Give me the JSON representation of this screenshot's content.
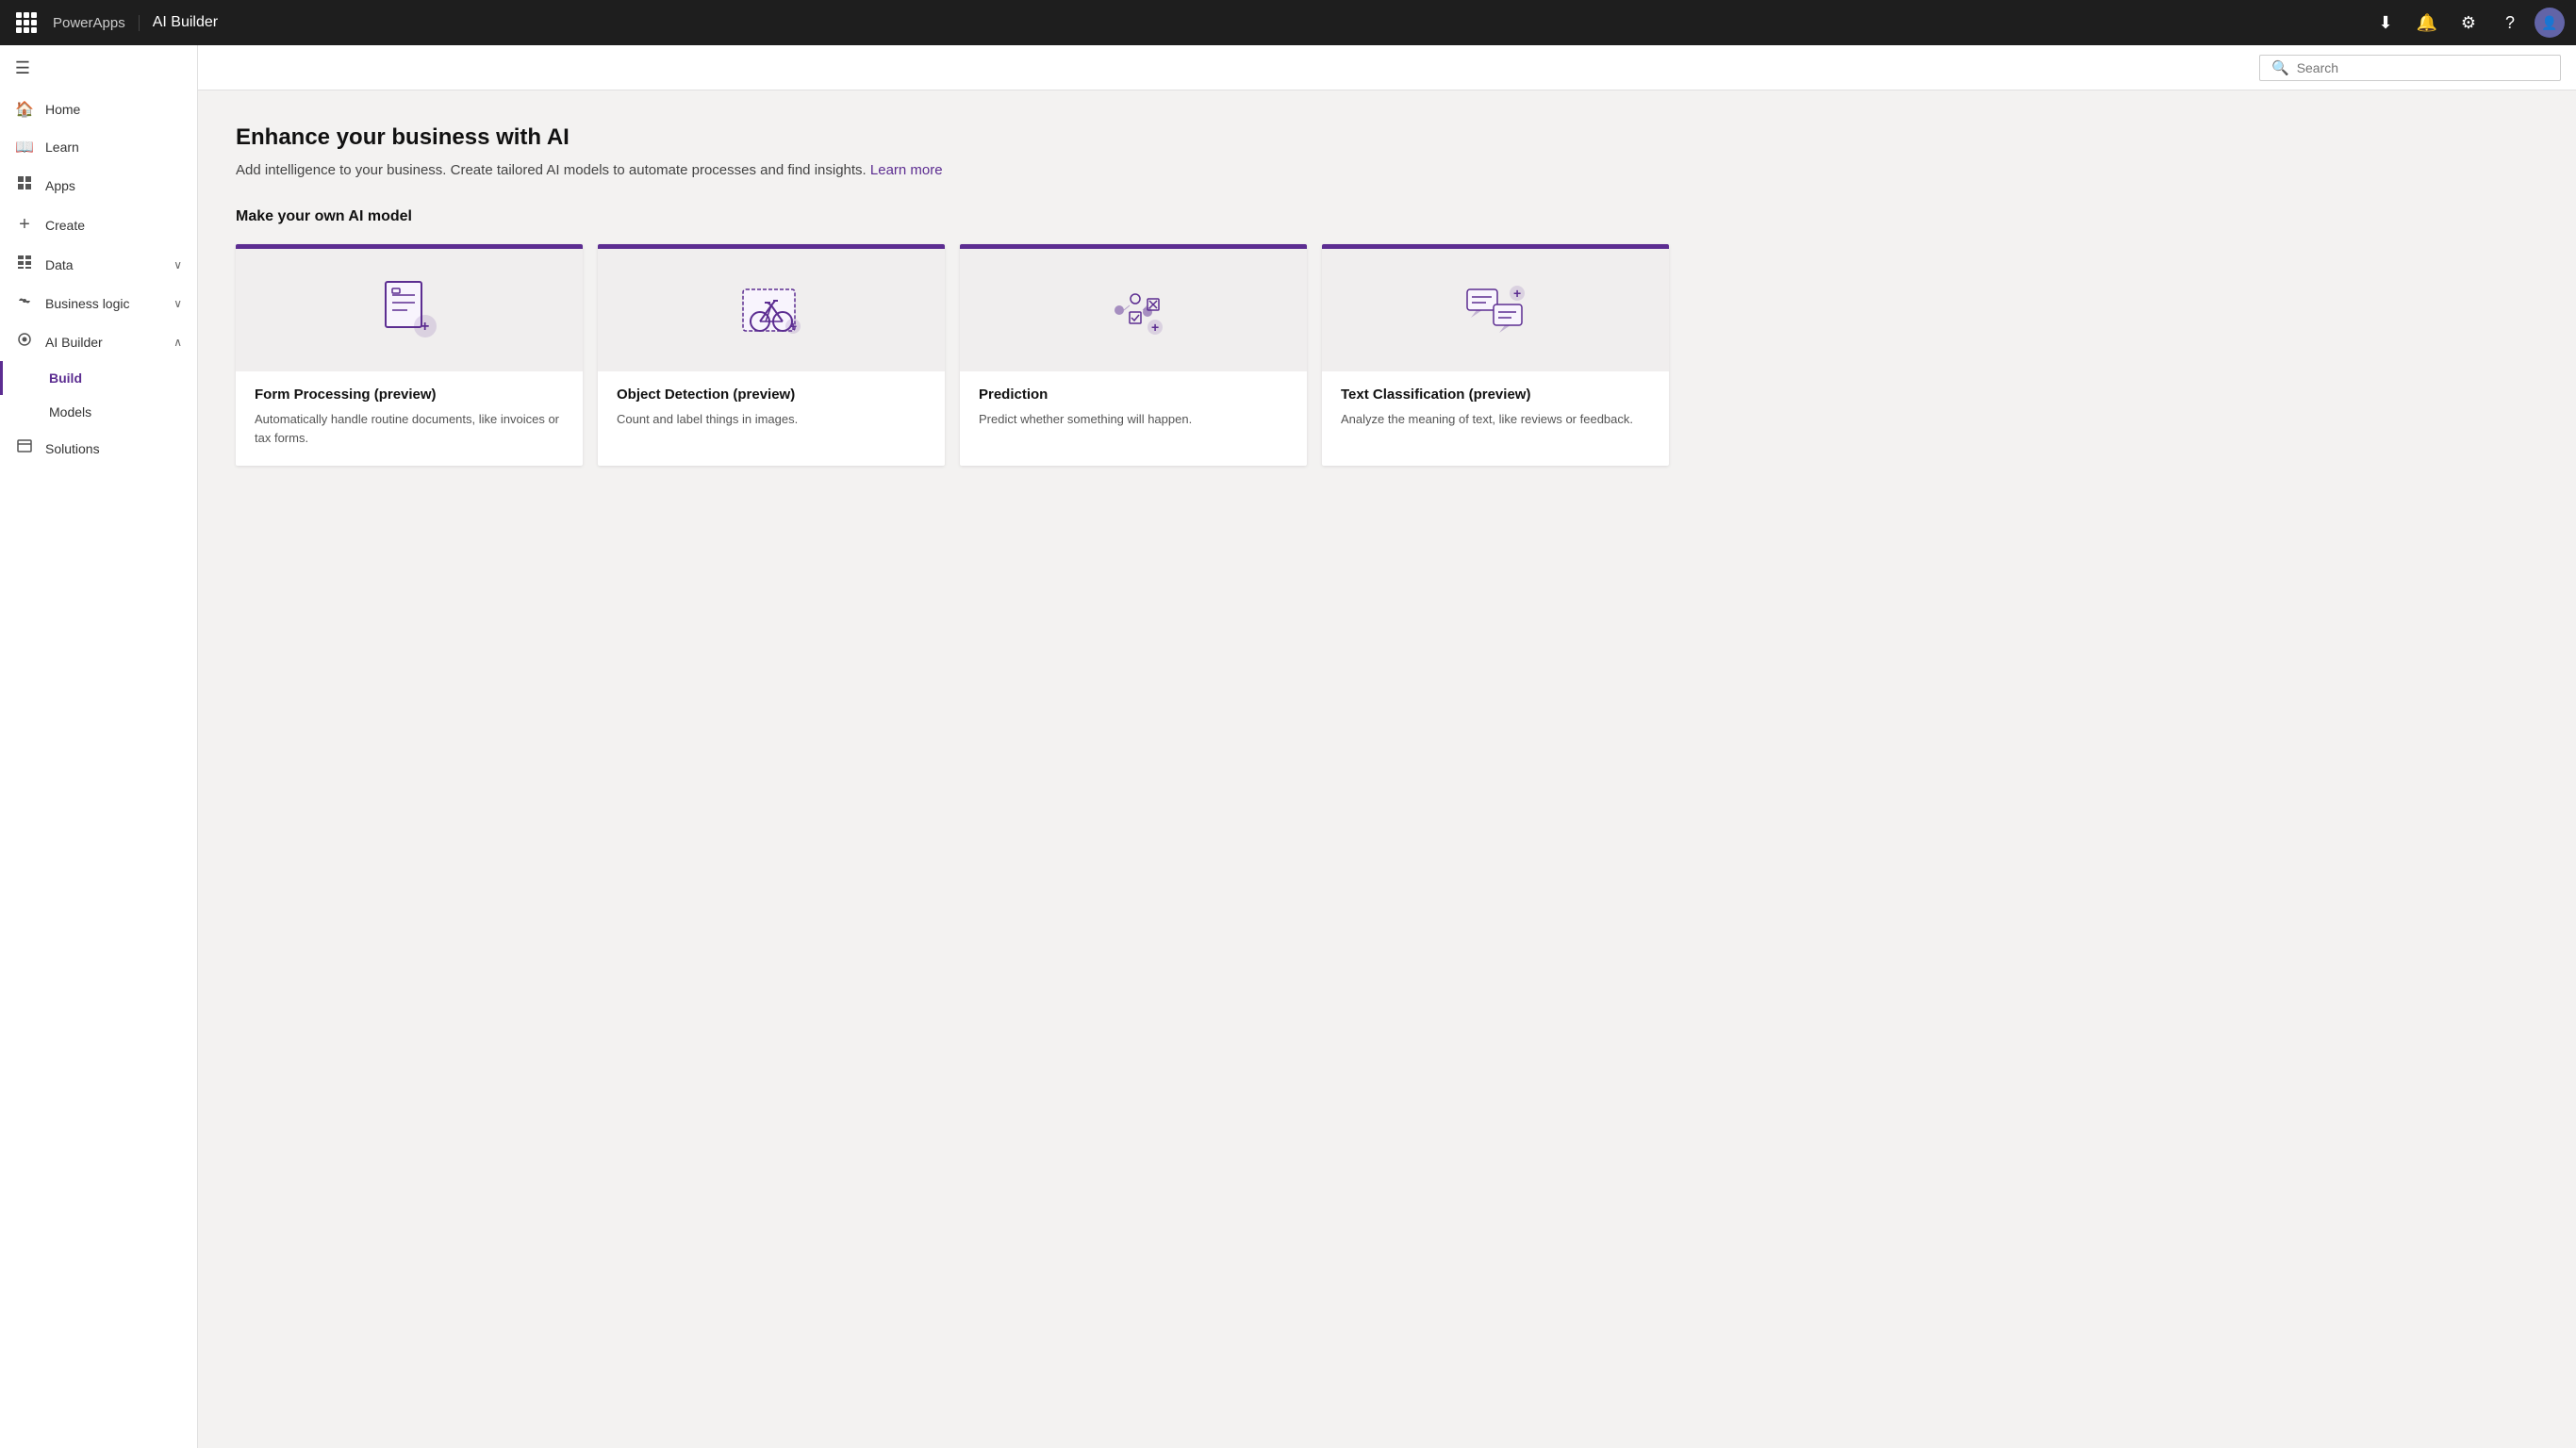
{
  "topbar": {
    "app_name": "PowerApps",
    "page_title": "AI Builder",
    "icons": {
      "download": "⬇",
      "notification": "🔔",
      "settings": "⚙",
      "help": "?"
    }
  },
  "search": {
    "placeholder": "Search"
  },
  "sidebar": {
    "collapse_label": "☰",
    "items": [
      {
        "id": "home",
        "label": "Home",
        "icon": "🏠"
      },
      {
        "id": "learn",
        "label": "Learn",
        "icon": "📖"
      },
      {
        "id": "apps",
        "label": "Apps",
        "icon": "⊞"
      },
      {
        "id": "create",
        "label": "Create",
        "icon": "+"
      },
      {
        "id": "data",
        "label": "Data",
        "icon": "⊡",
        "chevron": "∨"
      },
      {
        "id": "business-logic",
        "label": "Business logic",
        "icon": "⌥",
        "chevron": "∨"
      },
      {
        "id": "ai-builder",
        "label": "AI Builder",
        "icon": "◎",
        "chevron": "∧"
      }
    ],
    "ai_subitems": [
      {
        "id": "build",
        "label": "Build",
        "active": true
      },
      {
        "id": "models",
        "label": "Models"
      }
    ],
    "bottom_items": [
      {
        "id": "solutions",
        "label": "Solutions",
        "icon": "⧉"
      }
    ]
  },
  "main": {
    "heading": "Enhance your business with AI",
    "subtitle": "Add intelligence to your business. Create tailored AI models to automate processes and find insights.",
    "learn_more_label": "Learn more",
    "section_title": "Make your own AI model",
    "cards": [
      {
        "id": "form-processing",
        "title": "Form Processing (preview)",
        "description": "Automatically handle routine documents, like invoices or tax forms.",
        "icon_type": "form"
      },
      {
        "id": "object-detection",
        "title": "Object Detection (preview)",
        "description": "Count and label things in images.",
        "icon_type": "object"
      },
      {
        "id": "prediction",
        "title": "Prediction",
        "description": "Predict whether something will happen.",
        "icon_type": "prediction"
      },
      {
        "id": "text-classification",
        "title": "Text Classification (preview)",
        "description": "Analyze the meaning of text, like reviews or feedback.",
        "icon_type": "text"
      }
    ]
  }
}
